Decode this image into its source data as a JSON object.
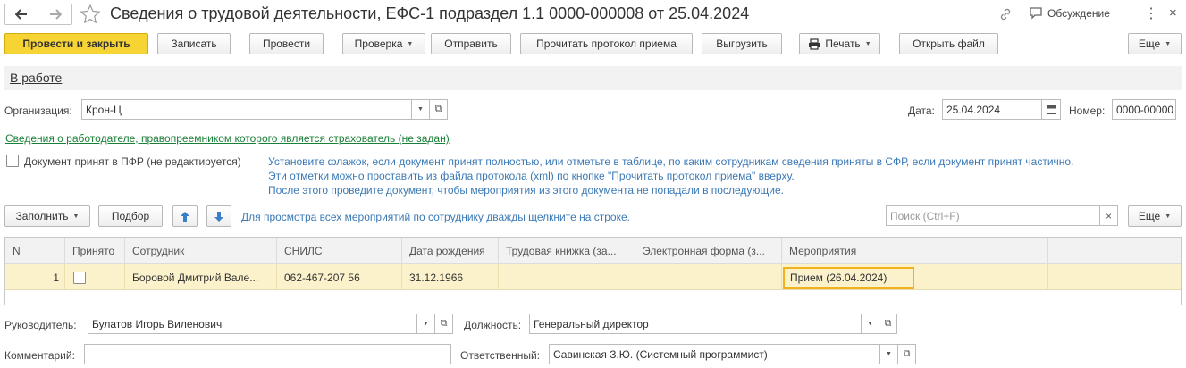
{
  "window": {
    "title": "Сведения о трудовой деятельности, ЕФС-1 подраздел 1.1 0000-000008 от 25.04.2024",
    "discussion_label": "Обсуждение"
  },
  "toolbar": {
    "post_and_close": "Провести и закрыть",
    "save": "Записать",
    "post": "Провести",
    "check": "Проверка",
    "send": "Отправить",
    "read_protocol": "Прочитать протокол приема",
    "export": "Выгрузить",
    "print": "Печать",
    "open_file": "Открыть файл",
    "more": "Еще"
  },
  "status": "В работе",
  "organization": {
    "label": "Организация:",
    "value": "Крон-Ц"
  },
  "date": {
    "label": "Дата:",
    "value": "25.04.2024"
  },
  "number": {
    "label": "Номер:",
    "value": "0000-00000"
  },
  "employer_link": "Сведения о работодателе, правопреемником которого является страхователь (не задан)",
  "accepted_pfr": {
    "label": "Документ принят в ПФР (не редактируется)",
    "hint_line1": "Установите флажок, если документ принят полностью, или отметьте в таблице, по каким сотрудникам сведения приняты в СФР, если документ принят частично.",
    "hint_line2": "Эти отметки можно проставить из файла протокола (xml) по кнопке \"Прочитать протокол приема\" вверху.",
    "hint_line3": "После этого проведите документ, чтобы мероприятия из этого документа не попадали в последующие."
  },
  "table_toolbar": {
    "fill": "Заполнить",
    "select": "Подбор",
    "hint": "Для просмотра всех мероприятий по сотруднику дважды щелкните на строке.",
    "search_placeholder": "Поиск (Ctrl+F)",
    "more": "Еще"
  },
  "table": {
    "columns": [
      "N",
      "Принято",
      "Сотрудник",
      "СНИЛС",
      "Дата рождения",
      "Трудовая книжка (за...",
      "Электронная форма (з...",
      "Мероприятия"
    ],
    "rows": [
      {
        "n": "1",
        "employee": "Боровой Дмитрий Вале...",
        "snils": "062-467-207 56",
        "birth": "31.12.1966",
        "book": "",
        "eform": "",
        "events": "Прием (26.04.2024)"
      }
    ]
  },
  "manager": {
    "label": "Руководитель:",
    "value": "Булатов Игорь Виленович"
  },
  "position": {
    "label": "Должность:",
    "value": "Генеральный директор"
  },
  "comment": {
    "label": "Комментарий:",
    "value": ""
  },
  "responsible": {
    "label": "Ответственный:",
    "value": "Савинская З.Ю. (Системный программист)"
  }
}
